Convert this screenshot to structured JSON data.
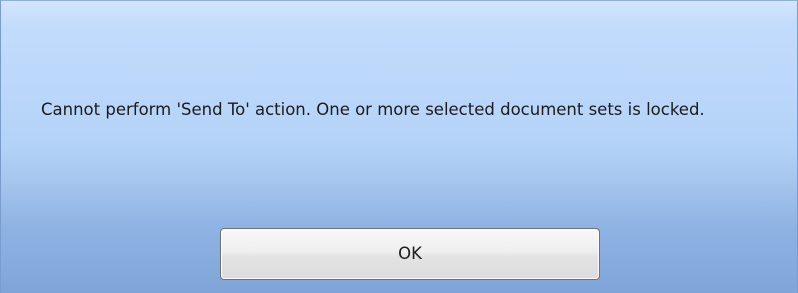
{
  "dialog": {
    "message": "Cannot perform 'Send To' action. One or more selected document sets is locked.",
    "ok_label": "OK"
  },
  "colors": {
    "background_top": "#c2dcfb",
    "background_bottom": "#7fa5d8",
    "button_face": "#eeeeee",
    "text": "#1b1b1b"
  }
}
